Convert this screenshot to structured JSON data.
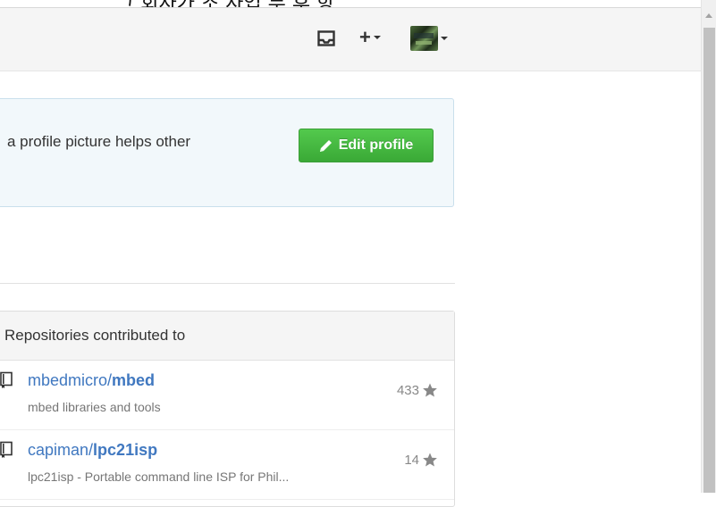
{
  "top_strip": {
    "text": "그 회사가 조 사업 무 후 항"
  },
  "header": {
    "icons": {
      "inbox": "inbox-icon",
      "plus": "plus-icon",
      "avatar": "avatar"
    },
    "plus_label": "+"
  },
  "notice": {
    "text": "a profile picture helps other",
    "edit_button_label": "Edit profile",
    "edit_icon": "pencil-icon"
  },
  "contributed": {
    "title": "Repositories contributed to",
    "repos": [
      {
        "owner": "mbedmicro/",
        "name": "mbed",
        "description": "mbed libraries and tools",
        "stars": "433"
      },
      {
        "owner": "capiman/",
        "name": "lpc21isp",
        "description": "lpc21isp - Portable command line ISP for Phil...",
        "stars": "14"
      }
    ]
  },
  "colors": {
    "link": "#4078c0",
    "button_green": "#44b540",
    "notice_bg": "#f2f8fb"
  }
}
